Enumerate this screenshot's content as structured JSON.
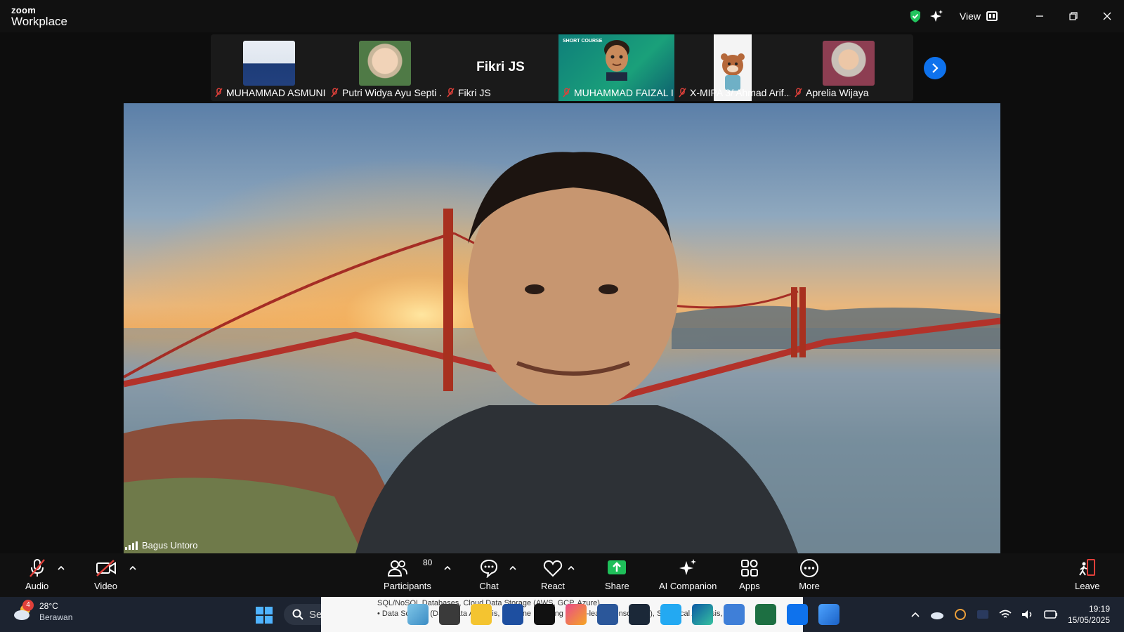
{
  "titlebar": {
    "brand_top": "zoom",
    "brand_bottom": "Workplace",
    "view_label": "View"
  },
  "gallery": {
    "participants": [
      {
        "name": "MUHAMMAD ASMUNI",
        "muted": true,
        "avatar": "photo"
      },
      {
        "name": "Putri Widya Ayu Septi ...",
        "muted": true,
        "avatar": "photo"
      },
      {
        "name": "Fikri JS",
        "muted": true,
        "avatar": "name-only",
        "big_name": "Fikri JS"
      },
      {
        "name": "MUHAMMAD FAIZAL I...",
        "muted": true,
        "avatar": "memoji",
        "banner": "SHORT COURSE"
      },
      {
        "name": "X-MIPA 3/ Ahmad Arif...",
        "muted": true,
        "avatar": "cartoon"
      },
      {
        "name": "Aprelia Wijaya",
        "muted": true,
        "avatar": "photo"
      }
    ]
  },
  "main_video": {
    "speaker_name": "Bagus Untoro"
  },
  "toolbar": {
    "audio_label": "Audio",
    "video_label": "Video",
    "participants_label": "Participants",
    "participants_count": "80",
    "chat_label": "Chat",
    "react_label": "React",
    "share_label": "Share",
    "ai_label": "AI Companion",
    "apps_label": "Apps",
    "more_label": "More",
    "leave_label": "Leave"
  },
  "taskbar": {
    "weather_badge": "4",
    "temperature": "28°C",
    "weather_desc": "Berawan",
    "search_placeholder": "Search",
    "preview_line1": "SQL/NoSQL Databases, Cloud Data Storage (AWS, GCP, Azure)",
    "preview_line2": "• Data Science (DS)( Data Analysis, Machine Learning (Scikit-learn, TensorFlow), Statistical Analysis, Data",
    "time": "19:19",
    "date": "15/05/2025"
  },
  "colors": {
    "accent": "#0e72ed",
    "share_green": "#1fbf5a",
    "muted_red": "#e0403a"
  }
}
